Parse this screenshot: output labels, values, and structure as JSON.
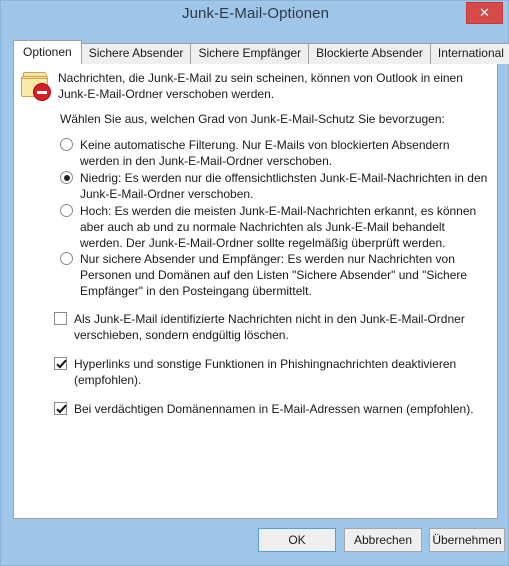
{
  "window": {
    "title": "Junk-E-Mail-Optionen",
    "close_label": "✕"
  },
  "tabs": [
    {
      "label": "Optionen",
      "active": true
    },
    {
      "label": "Sichere Absender",
      "active": false
    },
    {
      "label": "Sichere Empfänger",
      "active": false
    },
    {
      "label": "Blockierte Absender",
      "active": false
    },
    {
      "label": "International",
      "active": false
    }
  ],
  "content": {
    "intro": "Nachrichten, die Junk-E-Mail zu sein scheinen, können von Outlook in einen Junk-E-Mail-Ordner verschoben werden.",
    "prompt": "Wählen Sie aus, welchen Grad von Junk-E-Mail-Schutz Sie bevorzugen:",
    "radios": [
      {
        "label": "Keine automatische Filterung. Nur E-Mails von blockierten Absendern werden in den Junk-E-Mail-Ordner verschoben.",
        "checked": false
      },
      {
        "label": "Niedrig: Es werden nur die offensichtlichsten Junk-E-Mail-Nachrichten in den Junk-E-Mail-Ordner verschoben.",
        "checked": true
      },
      {
        "label": "Hoch: Es werden die meisten Junk-E-Mail-Nachrichten erkannt, es können aber auch ab und zu normale Nachrichten als Junk-E-Mail behandelt werden. Der Junk-E-Mail-Ordner sollte regelmäßig überprüft werden.",
        "checked": false
      },
      {
        "label": "Nur sichere Absender und Empfänger: Es werden nur Nachrichten von Personen und Domänen auf den Listen \"Sichere Absender\" und \"Sichere Empfänger\" in den Posteingang übermittelt.",
        "checked": false
      }
    ],
    "checkboxes": [
      {
        "label": "Als Junk-E-Mail identifizierte Nachrichten nicht in den Junk-E-Mail-Ordner verschieben, sondern endgültig löschen.",
        "checked": false
      },
      {
        "label": "Hyperlinks und sonstige Funktionen in Phishingnachrichten deaktivieren (empfohlen).",
        "checked": true
      },
      {
        "label": "Bei verdächtigen Domänennamen in E-Mail-Adressen warnen (empfohlen).",
        "checked": true
      }
    ]
  },
  "footer": {
    "ok": "OK",
    "cancel": "Abbrechen",
    "apply": "Übernehmen"
  },
  "colors": {
    "frame": "#9fc6e8",
    "close": "#d64a4a",
    "default_button_border": "#5a9fd4"
  }
}
